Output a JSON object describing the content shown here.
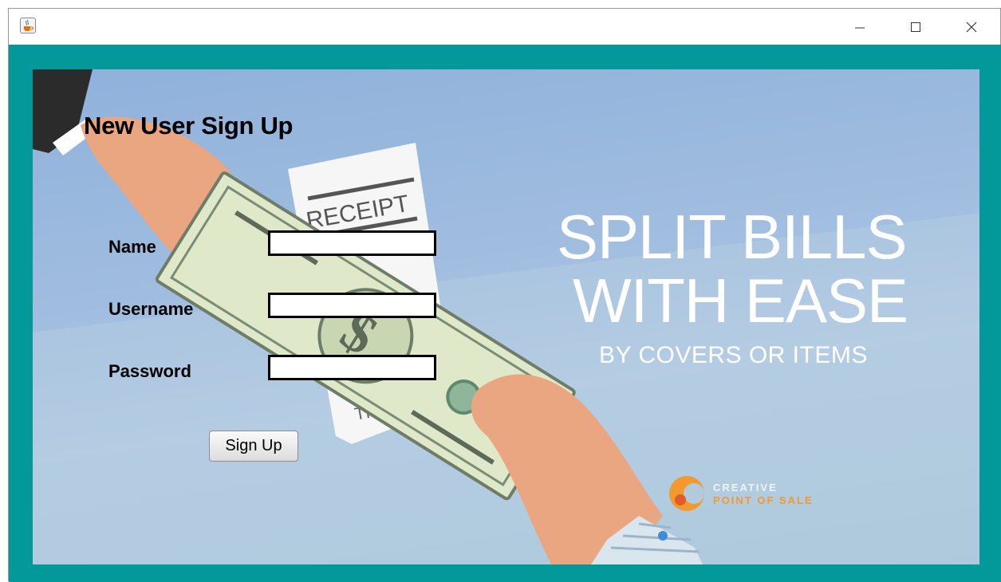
{
  "window": {
    "app_icon": "java-cup-icon",
    "controls": {
      "minimize": "minimize-icon",
      "maximize": "maximize-icon",
      "close": "close-icon"
    }
  },
  "form": {
    "title": "New User Sign Up",
    "fields": {
      "name": {
        "label": "Name",
        "value": ""
      },
      "username": {
        "label": "Username",
        "value": ""
      },
      "password": {
        "label": "Password",
        "value": ""
      }
    },
    "submit_label": "Sign Up"
  },
  "banner": {
    "receipt_text": "RECEIPT",
    "receipt_footer": "THAI",
    "headline_1": "SPLIT BILLS",
    "headline_2": "WITH EASE",
    "subheadline": "BY COVERS OR ITEMS",
    "brand_line_1": "CREATIVE",
    "brand_line_2": "POINT OF SALE"
  },
  "colors": {
    "frame": "#03999b",
    "background": "#a3bfe0",
    "brand_orange": "#f29a2e",
    "money_green": "#dfe8c8"
  }
}
